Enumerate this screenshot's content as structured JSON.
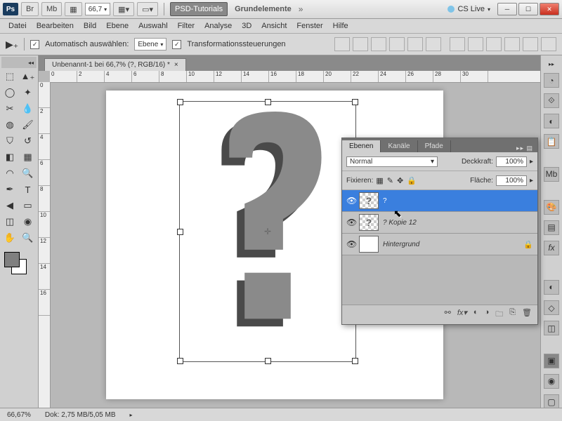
{
  "titlebar": {
    "logo": "Ps",
    "br": "Br",
    "mb": "Mb",
    "essentials": "▦",
    "zoom": "66,7",
    "viewbtns": "▦▾",
    "screen": "▭▾",
    "workspace_a": "PSD-Tutorials",
    "workspace_b": "Grundelemente",
    "arrows": "»",
    "cslive": "CS Live"
  },
  "menu": [
    "Datei",
    "Bearbeiten",
    "Bild",
    "Ebene",
    "Auswahl",
    "Filter",
    "Analyse",
    "3D",
    "Ansicht",
    "Fenster",
    "Hilfe"
  ],
  "optbar": {
    "auto_select": "Automatisch auswählen:",
    "auto_value": "Ebene",
    "transform": "Transformationssteuerungen"
  },
  "doc_tab": "Unbenannt-1 bei 66,7% (?, RGB/16) *",
  "ruler_h": [
    "0",
    "2",
    "4",
    "6",
    "8",
    "10",
    "12",
    "14",
    "16",
    "18",
    "20",
    "22",
    "24",
    "26",
    "28",
    "30"
  ],
  "ruler_v": [
    "0",
    "2",
    "4",
    "6",
    "8",
    "10",
    "12",
    "14",
    "16"
  ],
  "layers": {
    "tabs": [
      "Ebenen",
      "Kanäle",
      "Pfade"
    ],
    "blend": "Normal",
    "opacity_label": "Deckkraft:",
    "opacity": "100%",
    "lock_label": "Fixieren:",
    "fill_label": "Fläche:",
    "fill": "100%",
    "items": [
      {
        "name": "?",
        "sel": true
      },
      {
        "name": "? Kopie 12",
        "sel": false
      },
      {
        "name": "Hintergrund",
        "sel": false,
        "bg": true
      }
    ]
  },
  "status": {
    "zoom": "66,67%",
    "docsize": "Dok: 2,75 MB/5,05 MB"
  }
}
